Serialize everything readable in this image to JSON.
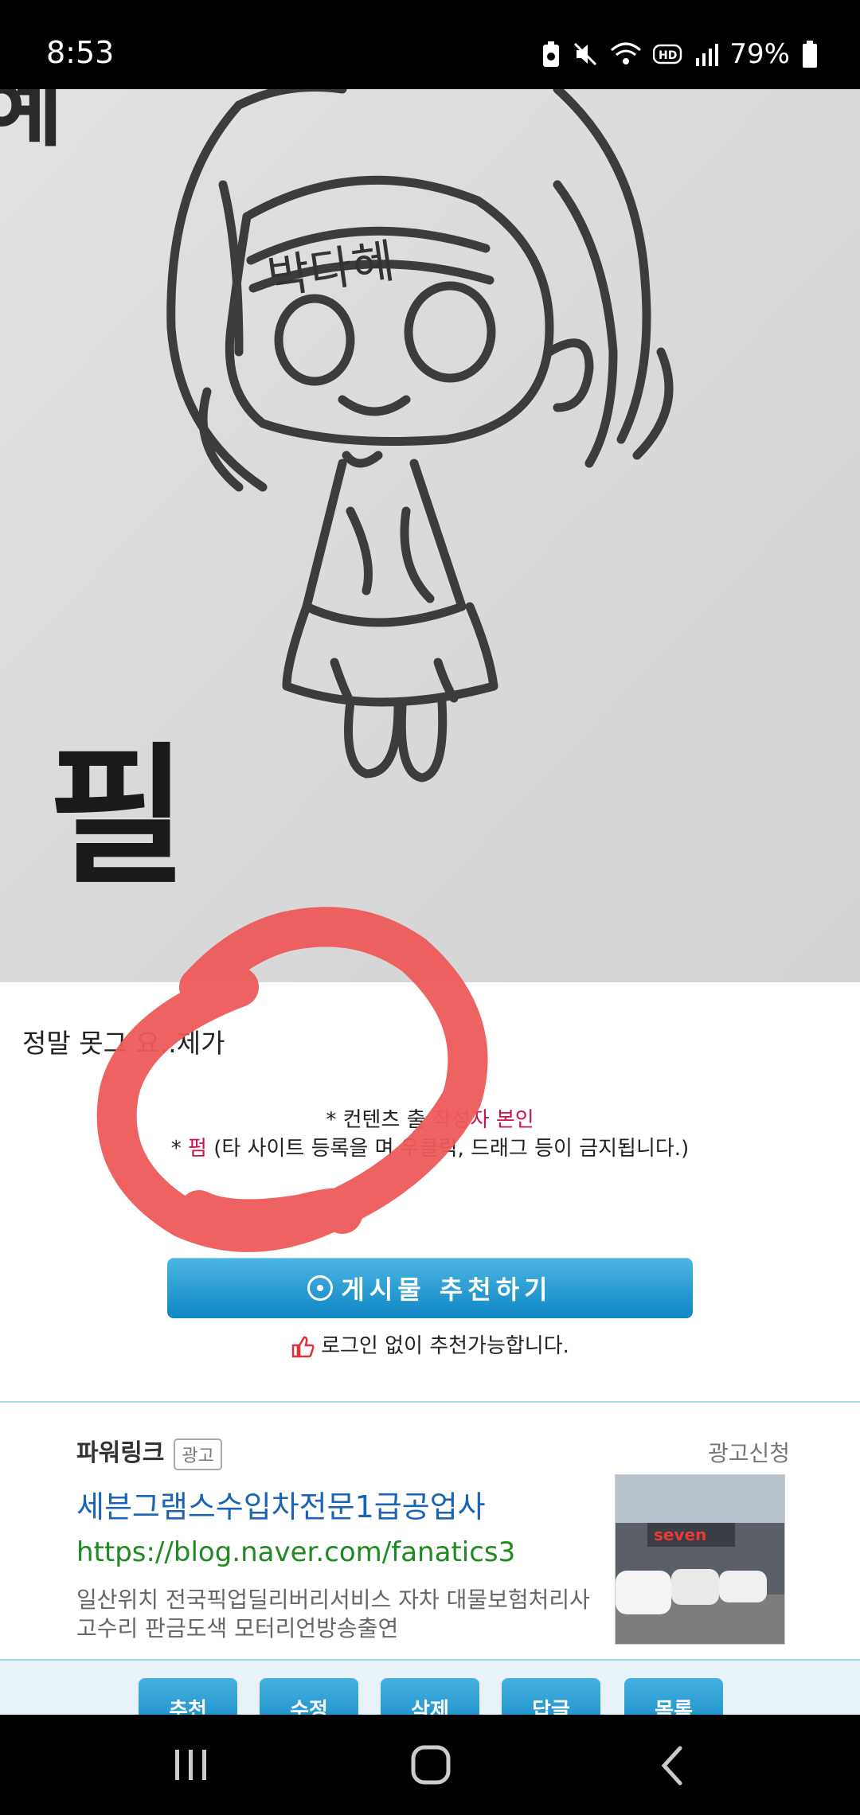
{
  "status_bar": {
    "time": "8:53",
    "battery": "79%"
  },
  "photo": {
    "headband_text": "박다혜",
    "corner_text_top": "혜",
    "corner_text_bottom": "필"
  },
  "post": {
    "text": "정말 못그  요..제가",
    "notice1_prefix": "* 컨텐츠 출",
    "notice1_red": "작성자 본인",
    "notice2_prefix": "* ",
    "notice2_red": "펌",
    "notice2_rest": "(타 사이트 등록을      며 우클릭, 드래그 등이 금지됩니다.)"
  },
  "recommend": {
    "button_label": "게시물  추천하기",
    "note": "로그인 없이 추천가능합니다."
  },
  "ad": {
    "header": "파워링크",
    "badge": "광고",
    "apply": "광고신청",
    "title": "세븐그램스수입차전문1급공업사",
    "url": "https://blog.naver.com/fanatics3",
    "description": "일산위치 전국픽업딜리버리서비스 자차 대물보험처리사고수리 판금도색 모터리언방송출연",
    "image_sign": "seven"
  },
  "bottom_buttons": [
    "추천",
    "수정",
    "삭제",
    "답글",
    "목록"
  ],
  "colors": {
    "annotation_circle": "#ee5a5a",
    "button_blue": "#1489c6",
    "link_blue": "#1b63b5",
    "url_green": "#1f8a1f",
    "notice_red": "#c8144a"
  }
}
